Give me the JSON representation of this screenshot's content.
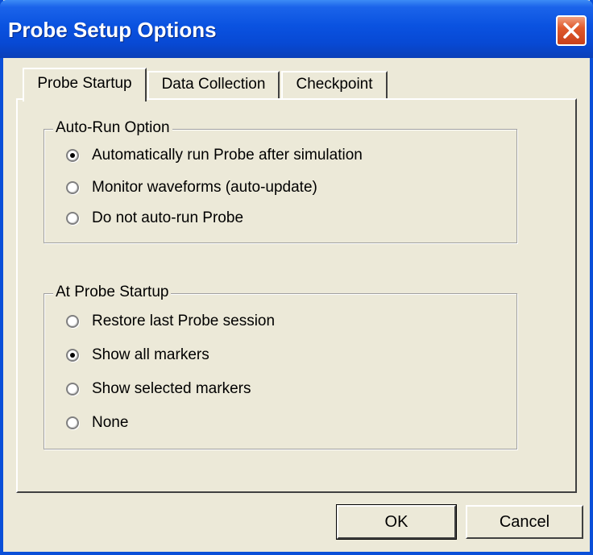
{
  "window": {
    "title": "Probe Setup Options"
  },
  "tabs": [
    {
      "label": "Probe Startup",
      "active": true
    },
    {
      "label": "Data Collection",
      "active": false
    },
    {
      "label": "Checkpoint",
      "active": false
    }
  ],
  "auto_run_group": {
    "label": "Auto-Run Option",
    "options": [
      {
        "label": "Automatically run Probe after simulation",
        "checked": true
      },
      {
        "label": "Monitor waveforms (auto-update)",
        "checked": false
      },
      {
        "label": "Do not auto-run Probe",
        "checked": false
      }
    ]
  },
  "startup_group": {
    "label": "At Probe Startup",
    "options": [
      {
        "label": "Restore last Probe session",
        "checked": false
      },
      {
        "label": "Show all markers",
        "checked": true
      },
      {
        "label": "Show selected markers",
        "checked": false
      },
      {
        "label": "None",
        "checked": false
      }
    ]
  },
  "buttons": {
    "ok": "OK",
    "cancel": "Cancel"
  },
  "icons": {
    "close": "close-icon"
  },
  "colors": {
    "titlebar": "#0a52e0",
    "close_button": "#e05a2c",
    "dialog_bg": "#ece9d8"
  }
}
